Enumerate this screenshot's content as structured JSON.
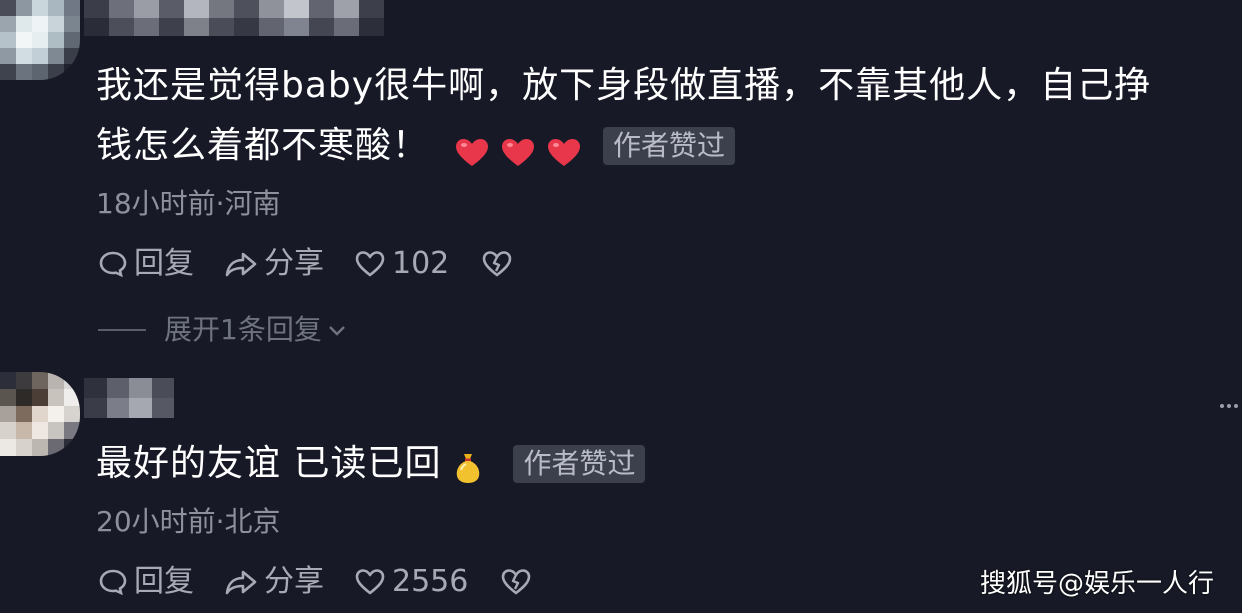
{
  "comments": [
    {
      "text_line1": "我还是觉得baby很牛啊，放下身段做直播，不靠其他人，自己挣",
      "text_line2": "钱怎么着都不寒酸！",
      "emojis": [
        "red-heart",
        "red-heart",
        "red-heart"
      ],
      "author_badge": "作者赞过",
      "meta": "18小时前·河南",
      "reply_label": "回复",
      "share_label": "分享",
      "like_count": "102",
      "expand_label": "展开1条回复"
    },
    {
      "text_line1": "最好的友谊 已读已回",
      "emojis": [
        "money-bag"
      ],
      "author_badge": "作者赞过",
      "meta": "20小时前·北京",
      "reply_label": "回复",
      "share_label": "分享",
      "like_count": "2556"
    }
  ],
  "watermark": "搜狐号@娱乐一人行",
  "colors": {
    "background": "#171a26",
    "text": "#ffffff",
    "meta": "#8e919c",
    "badge_bg": "#3c3f4c",
    "heart": "#e8364a"
  }
}
